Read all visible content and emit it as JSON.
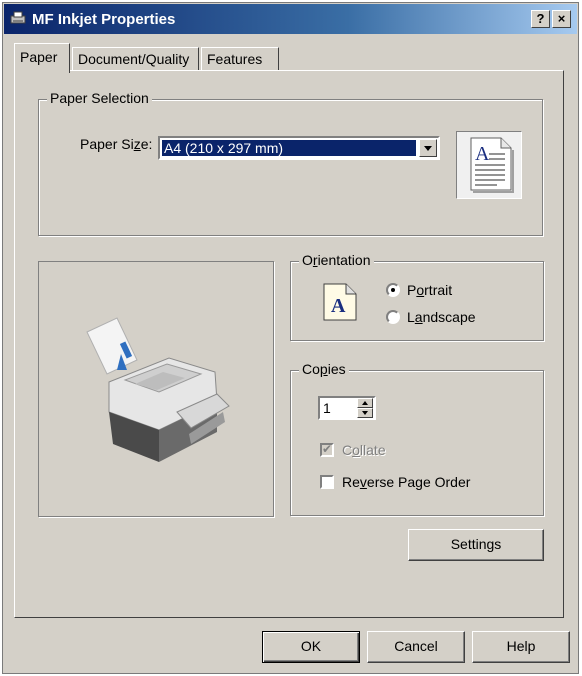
{
  "window": {
    "title": "MF Inkjet Properties",
    "help_label": "?",
    "close_label": "×"
  },
  "tabs": [
    {
      "label": "Paper"
    },
    {
      "label": "Document/Quality"
    },
    {
      "label": "Features"
    }
  ],
  "paper_selection": {
    "group_label": "Paper Selection",
    "size_label_pre": "Paper Si",
    "size_label_key": "z",
    "size_label_post": "e:",
    "size_value": "A4 (210 x 297 mm)"
  },
  "orientation": {
    "group_label_pre": "O",
    "group_label_key": "r",
    "group_label_post": "ientation",
    "portrait_pre": "P",
    "portrait_key": "o",
    "portrait_post": "rtrait",
    "landscape_pre": "L",
    "landscape_key": "a",
    "landscape_post": "ndscape",
    "selected": "Portrait",
    "icon_letter": "A"
  },
  "copies": {
    "group_label_pre": "Co",
    "group_label_key": "p",
    "group_label_post": "ies",
    "value": "1",
    "collate_pre": "C",
    "collate_key": "o",
    "collate_post": "llate",
    "reverse_pre": "Re",
    "reverse_key": "v",
    "reverse_post": "erse Page Order",
    "settings_label": "Settings"
  },
  "preview": {
    "letter": "A"
  },
  "buttons": {
    "ok": "OK",
    "cancel": "Cancel",
    "help": "Help"
  },
  "colors": {
    "face": "#d4d0c8",
    "titlebar_start": "#0a246a",
    "titlebar_end": "#a6caf0",
    "selection": "#0a246a"
  }
}
